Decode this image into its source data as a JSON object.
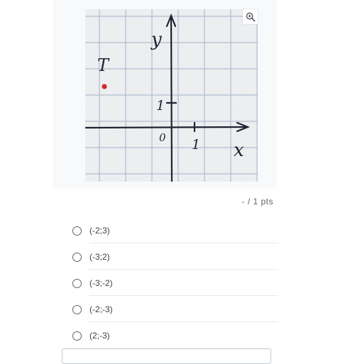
{
  "figure": {
    "point_label": "T",
    "y_label": "y",
    "x_label": "x",
    "origin_label": "0",
    "unit_y_label": "1",
    "unit_x_label": "1",
    "zoom_icon": "zoom-in-icon",
    "point_color": "#d22b2b",
    "ink_color": "#1f2330",
    "grid_color": "#9aa7c2"
  },
  "score": {
    "text": "- / 1 pts"
  },
  "options": [
    {
      "label": "(-2;3)"
    },
    {
      "label": "(-3;2)"
    },
    {
      "label": "(-3;-2)"
    },
    {
      "label": "(-2;-3)"
    },
    {
      "label": "(2;-3)"
    }
  ]
}
